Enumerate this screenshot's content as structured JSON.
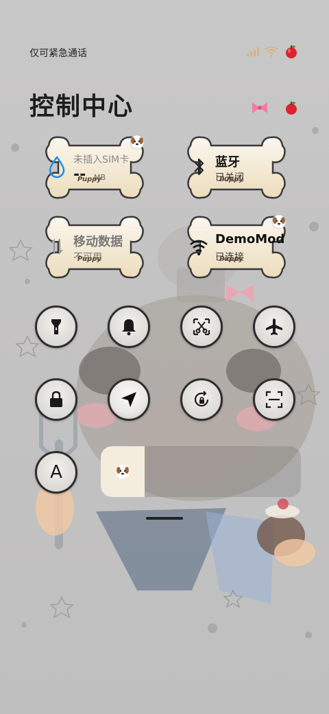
{
  "status_bar": {
    "carrier_text": "仅可紧急通话",
    "icons": [
      "signal-icon",
      "wifi-icon",
      "apple-icon"
    ]
  },
  "header": {
    "title": "控制中心",
    "decorations": [
      "bow-icon",
      "apple-icon"
    ]
  },
  "tiles": [
    {
      "id": "data-usage",
      "title": "未插入SIM卡",
      "value": "--",
      "unit": "MB",
      "badge": "Puppy",
      "state": "disabled"
    },
    {
      "id": "bluetooth",
      "title": "蓝牙",
      "subtitle": "已关闭",
      "badge": "Puppy",
      "state": "off"
    },
    {
      "id": "mobile-data",
      "title": "移动数据",
      "subtitle": "不可用",
      "badge": "Puppy",
      "state": "disabled"
    },
    {
      "id": "wifi",
      "title": "DemoMode",
      "subtitle": "已连接",
      "badge": "Puppy",
      "state": "on"
    }
  ],
  "toggles": [
    {
      "id": "flashlight",
      "icon": "flashlight-icon",
      "active": false
    },
    {
      "id": "mute",
      "icon": "bell-icon",
      "active": false
    },
    {
      "id": "screenshot",
      "icon": "scissors-icon",
      "active": false
    },
    {
      "id": "airplane",
      "icon": "airplane-icon",
      "active": false
    },
    {
      "id": "lock",
      "icon": "lock-icon",
      "active": false
    },
    {
      "id": "location",
      "icon": "location-arrow-icon",
      "active": true
    },
    {
      "id": "rotation-lock",
      "icon": "rotation-lock-icon",
      "active": false
    },
    {
      "id": "scanner",
      "icon": "scan-icon",
      "active": false
    },
    {
      "id": "auto-brightness",
      "icon": "auto-brightness-icon",
      "label": "A",
      "active": false
    }
  ],
  "brightness": {
    "level": 0.22,
    "icon": "dog-face-icon"
  },
  "colors": {
    "tile_cream": "#f4ead6",
    "tile_outline": "#3a3a3a",
    "accent_blue": "#1e8fe6",
    "badge_brown": "#5a4a35"
  }
}
